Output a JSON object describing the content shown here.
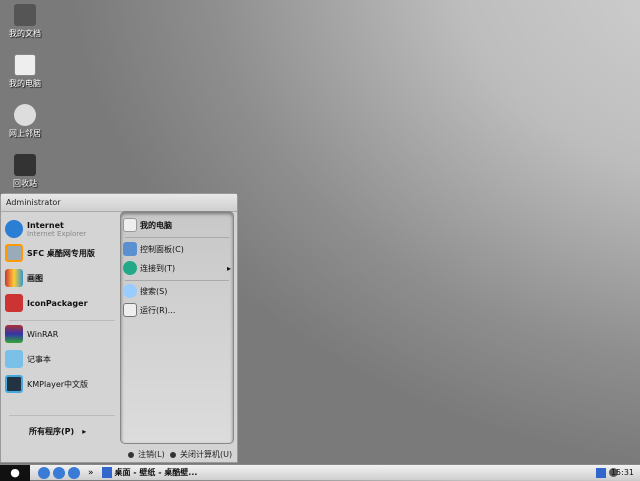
{
  "desktop": [
    {
      "label": "我的文档"
    },
    {
      "label": "我的电脑"
    },
    {
      "label": "网上邻居"
    },
    {
      "label": "回收站"
    }
  ],
  "start_menu": {
    "user": "Administrator",
    "pinned": [
      {
        "label": "Internet",
        "sub": "Internet Explorer"
      },
      {
        "label": "SFC 桌酷网专用版"
      },
      {
        "label": "画图"
      },
      {
        "label": "IconPackager"
      }
    ],
    "recent": [
      {
        "label": "WinRAR"
      },
      {
        "label": "记事本"
      },
      {
        "label": "KMPlayer中文版"
      }
    ],
    "all_programs": "所有程序(P)",
    "right": [
      {
        "label": "我的电脑"
      },
      {
        "label": "控制面板(C)"
      },
      {
        "label": "连接到(T)"
      },
      {
        "label": "搜索(S)"
      },
      {
        "label": "运行(R)..."
      }
    ],
    "logoff": "注销(L)",
    "shutdown": "关闭计算机(U)"
  },
  "taskbar": {
    "more": "»",
    "window": "桌面 - 壁纸 - 桌酷壁...",
    "clock": "15:31"
  }
}
